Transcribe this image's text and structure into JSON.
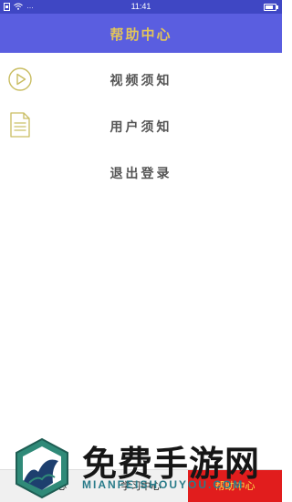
{
  "status_bar": {
    "left_text": "…",
    "time": "11:41",
    "battery_level": 0.8
  },
  "header": {
    "title": "帮助中心"
  },
  "menu": [
    {
      "label": "视频须知",
      "icon": "play-circle-icon"
    },
    {
      "label": "用户须知",
      "icon": "document-icon"
    },
    {
      "label": "退出登录",
      "icon": ""
    }
  ],
  "bottom_nav": [
    {
      "label": "心"
    },
    {
      "label": "学习中心"
    },
    {
      "label": "帮助中心",
      "active": true
    }
  ],
  "watermark": {
    "main": "免费手游网",
    "sub": "MIANFEISHOUYOU.COM"
  },
  "colors": {
    "status_bar": "#3f47c4",
    "title_bar": "#5a5ee0",
    "title_text": "#e2c55a",
    "icon_stroke": "#c9bd62",
    "active_tab": "#e11d1d",
    "active_tab_text": "#ffe24a"
  }
}
